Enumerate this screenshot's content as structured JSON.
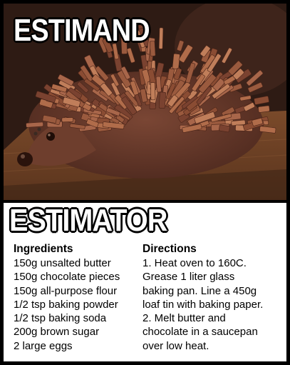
{
  "top": {
    "caption": "ESTIMAND",
    "photo_icon": "chocolate-hedgehog-cake-image"
  },
  "bottom": {
    "caption": "ESTIMATOR",
    "ingredients": {
      "heading": "Ingredients",
      "items": [
        "150g unsalted butter",
        "150g chocolate pieces",
        "150g all-purpose flour",
        "1/2 tsp baking powder",
        "1/2 tsp baking soda",
        "200g brown sugar",
        "2 large eggs"
      ]
    },
    "directions": {
      "heading": "Directions",
      "lines": [
        "1. Heat oven to 160C.",
        "Grease 1 liter glass",
        "baking pan. Line a 450g",
        "loaf tin with baking paper.",
        "2. Melt butter and",
        "chocolate in a saucepan",
        "over low heat."
      ]
    }
  }
}
